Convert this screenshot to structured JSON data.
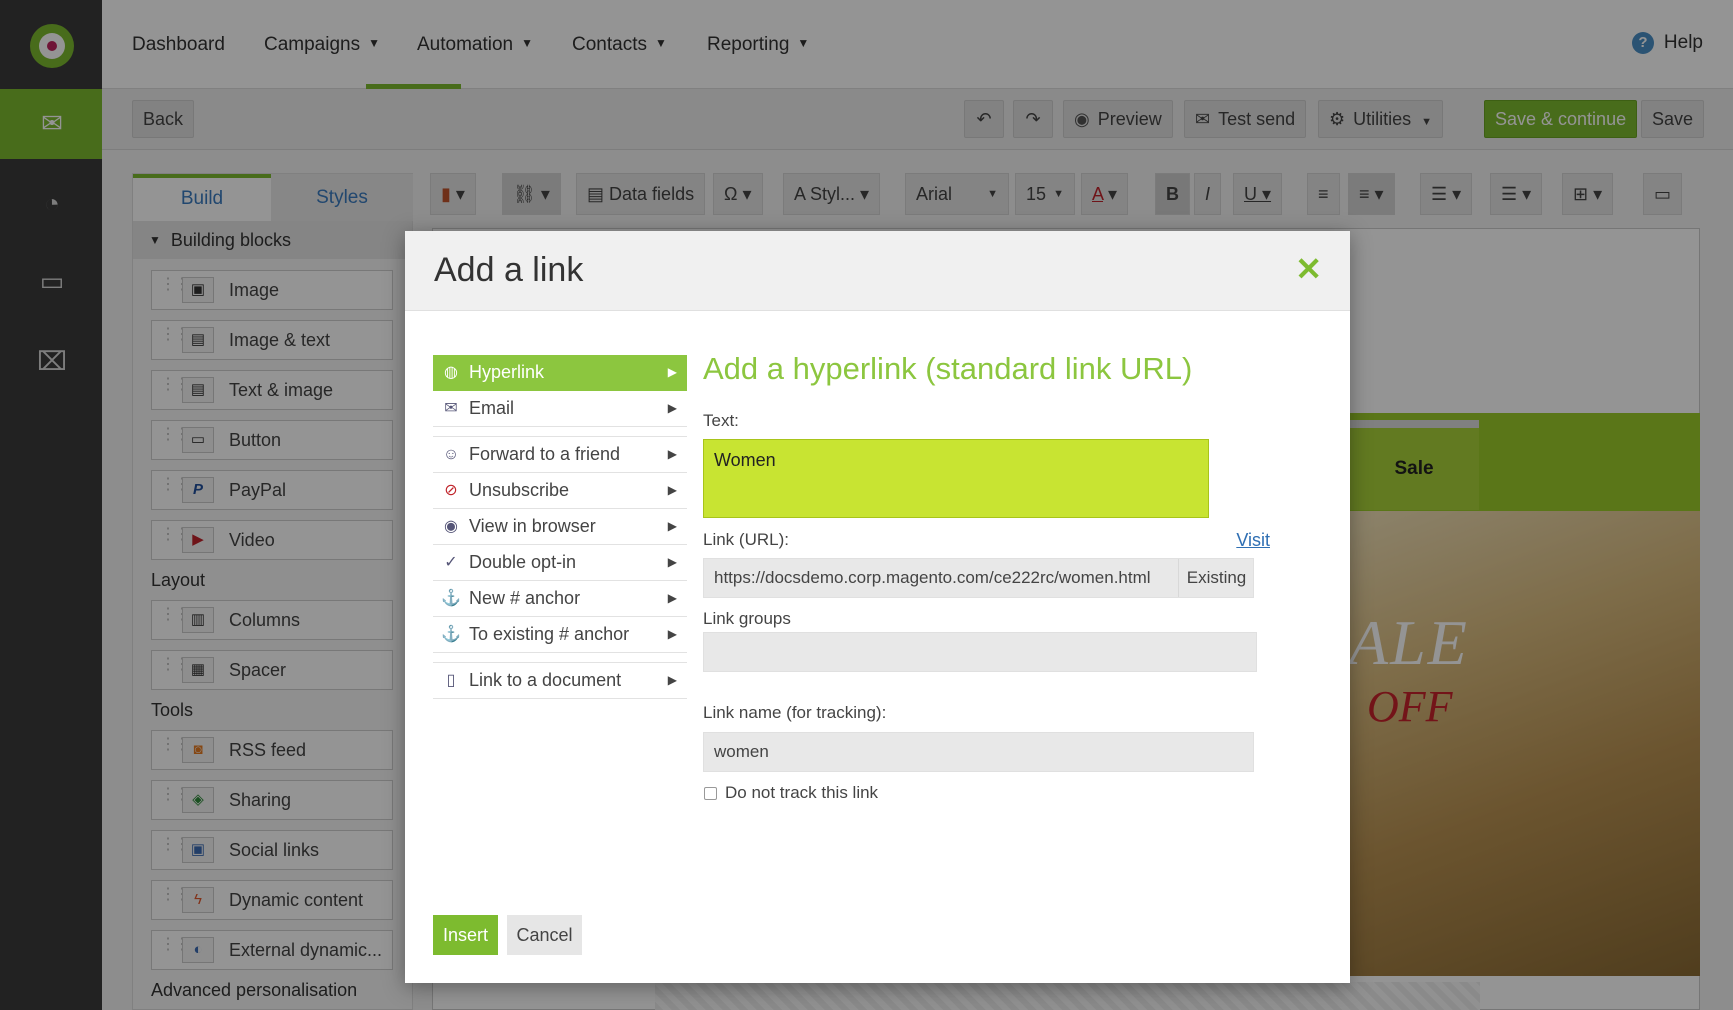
{
  "nav": {
    "items": [
      "Dashboard",
      "Campaigns",
      "Automation",
      "Contacts",
      "Reporting"
    ],
    "help": "Help"
  },
  "toolbar": {
    "back": "Back",
    "preview": "Preview",
    "test_send": "Test send",
    "utilities": "Utilities",
    "save_continue": "Save & continue",
    "save": "Save"
  },
  "panel": {
    "tabs": [
      "Build",
      "Styles"
    ],
    "building_blocks": "Building blocks",
    "blocks": [
      "Image",
      "Image & text",
      "Text & image",
      "Button",
      "PayPal",
      "Video"
    ],
    "layout_label": "Layout",
    "layout": [
      "Columns",
      "Spacer"
    ],
    "tools_label": "Tools",
    "tools": [
      "RSS feed",
      "Sharing",
      "Social links",
      "Dynamic content",
      "External dynamic..."
    ],
    "advanced_label": "Advanced personalisation"
  },
  "editor": {
    "data_fields": "Data fields",
    "styles": "Styl...",
    "font": "Arial",
    "size": "15"
  },
  "canvas": {
    "sale": "Sale",
    "hero_text": "ALE",
    "hero_sub": "OFF"
  },
  "modal": {
    "title": "Add a link",
    "menu": [
      "Hyperlink",
      "Email",
      "Forward to a friend",
      "Unsubscribe",
      "View in browser",
      "Double opt-in",
      "New # anchor",
      "To existing # anchor",
      "Link to a document"
    ],
    "heading": "Add a hyperlink (standard link URL)",
    "text_label": "Text:",
    "text_value": "Women",
    "url_label": "Link (URL):",
    "visit": "Visit",
    "url_value": "https://docsdemo.corp.magento.com/ce222rc/women.html",
    "existing": "Existing",
    "groups_label": "Link groups",
    "name_label": "Link name (for tracking):",
    "name_value": "women",
    "no_track": "Do not track this link",
    "insert": "Insert",
    "cancel": "Cancel"
  },
  "colors": {
    "accent": "#7dbb2f",
    "rail": "#3b3b3b",
    "text_highlight": "#c8e432"
  }
}
